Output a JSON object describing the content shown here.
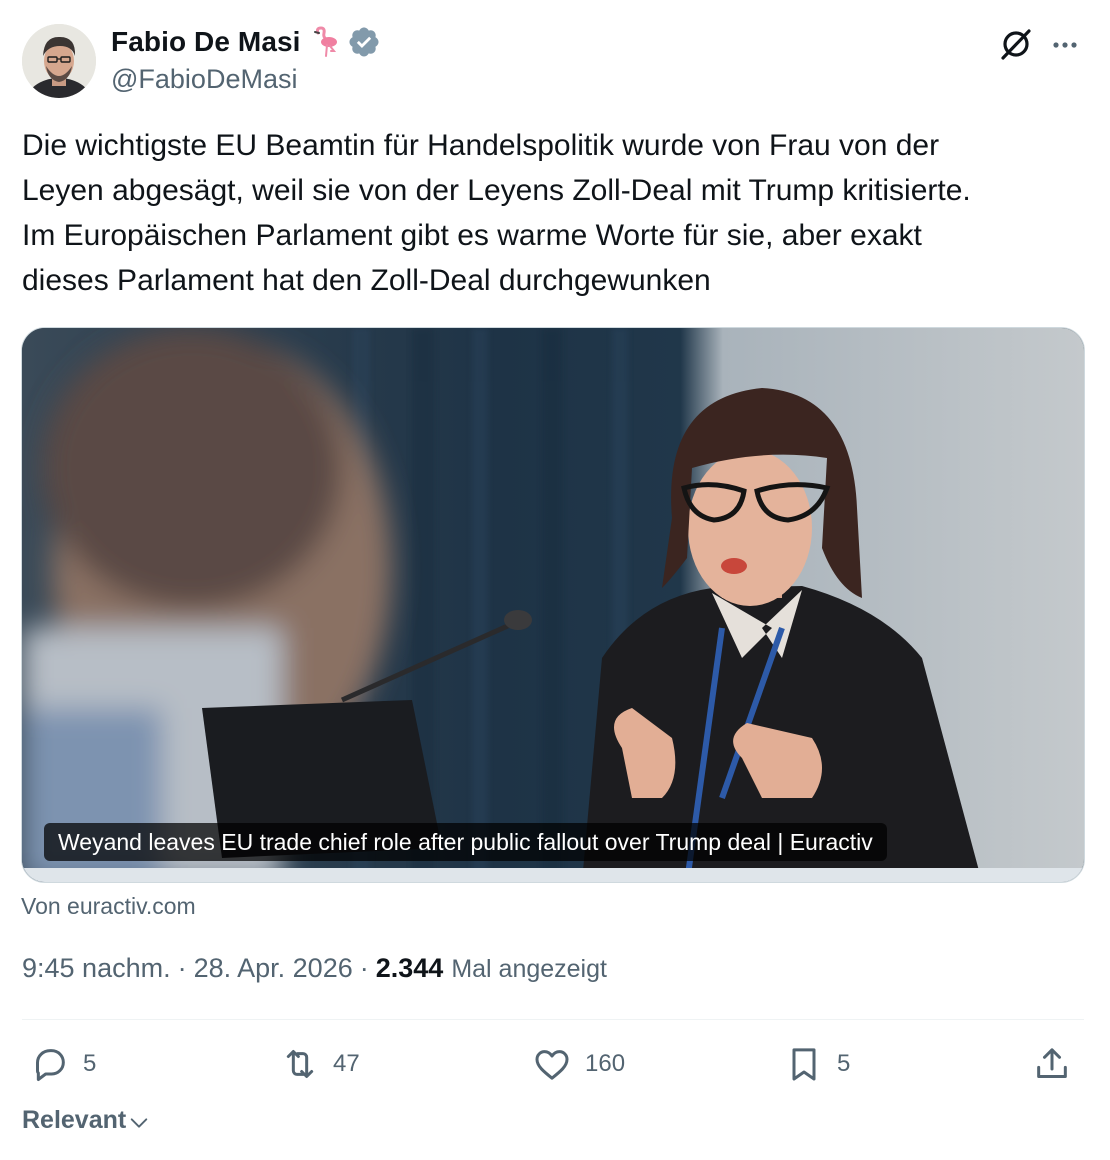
{
  "author": {
    "name": "Fabio De Masi",
    "handle": "@FabioDeMasi",
    "emoji_icon": "flamingo-icon",
    "verified_badge_icon": "verified-badge-icon",
    "verified_badge_color": "#829aab"
  },
  "tweet": {
    "text": "Die wichtigste EU Beamtin für Handelspolitik wurde von Frau von der\nLeyen abgesägt, weil sie von der Leyens Zoll-Deal mit Trump kritisierte.\nIm Europäischen Parlament gibt es warme Worte für sie, aber exakt\ndieses Parlament hat den Zoll-Deal durchgewunken"
  },
  "link_card": {
    "caption": "Weyand leaves EU trade chief role after public fallout over Trump deal | Euractiv",
    "source": "Von euractiv.com"
  },
  "meta": {
    "time": "9:45 nachm.",
    "separator": "·",
    "date": "28. Apr. 2026",
    "views_count": "2.344",
    "views_label": "Mal angezeigt"
  },
  "actions": {
    "replies": "5",
    "reposts": "47",
    "likes": "160",
    "bookmarks": "5"
  },
  "sort": {
    "label": "Relevant"
  },
  "colors": {
    "text_primary": "#0f1419",
    "text_secondary": "#536471",
    "divider": "#eff3f4"
  }
}
